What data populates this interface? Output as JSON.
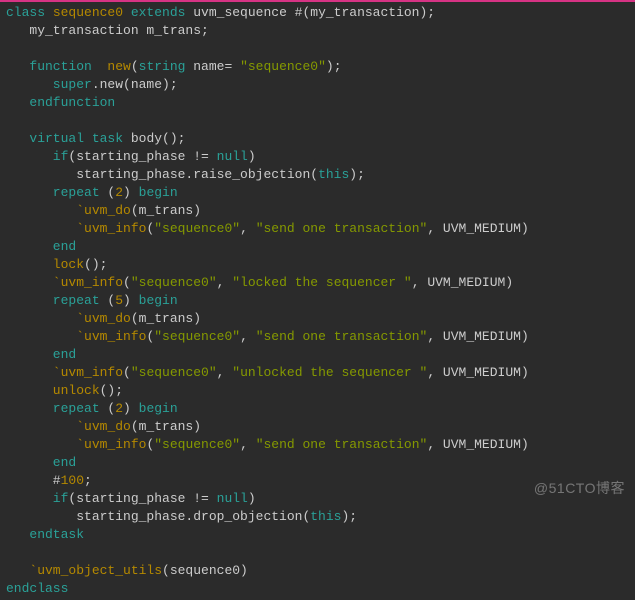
{
  "watermark": "@51CTO博客",
  "code": {
    "l1": {
      "a": "class ",
      "b": "sequence0 ",
      "c": "extends ",
      "d": "uvm_sequence #(my_transaction);"
    },
    "l2": "   my_transaction m_trans;",
    "l3": "",
    "l4": {
      "a": "   function  ",
      "b": "new",
      "c": "(",
      "d": "string ",
      "e": "name= ",
      "f": "\"sequence0\"",
      "g": ");"
    },
    "l5": {
      "a": "      super",
      "b": ".new(name);"
    },
    "l6": {
      "a": "   endfunction"
    },
    "l7": "",
    "l8": {
      "a": "   virtual ",
      "b": "task ",
      "c": "body();"
    },
    "l9": {
      "a": "      if",
      "b": "(starting_phase != ",
      "c": "null",
      "d": ")"
    },
    "l10": {
      "a": "         starting_phase.raise_objection(",
      "b": "this",
      "c": ");"
    },
    "l11": {
      "a": "      repeat ",
      "b": "(",
      "c": "2",
      "d": ") ",
      "e": "begin"
    },
    "l12": {
      "a": "         `uvm_do",
      "b": "(m_trans)"
    },
    "l13": {
      "a": "         `uvm_info",
      "b": "(",
      "c": "\"sequence0\"",
      "d": ", ",
      "e": "\"send one transaction\"",
      "f": ", UVM_MEDIUM)"
    },
    "l14": {
      "a": "      end"
    },
    "l15": {
      "a": "      lock",
      "b": "();"
    },
    "l16": {
      "a": "      `uvm_info",
      "b": "(",
      "c": "\"sequence0\"",
      "d": ", ",
      "e": "\"locked the sequencer \"",
      "f": ", UVM_MEDIUM)"
    },
    "l17": {
      "a": "      repeat ",
      "b": "(",
      "c": "5",
      "d": ") ",
      "e": "begin"
    },
    "l18": {
      "a": "         `uvm_do",
      "b": "(m_trans)"
    },
    "l19": {
      "a": "         `uvm_info",
      "b": "(",
      "c": "\"sequence0\"",
      "d": ", ",
      "e": "\"send one transaction\"",
      "f": ", UVM_MEDIUM)"
    },
    "l20": {
      "a": "      end"
    },
    "l21": {
      "a": "      `uvm_info",
      "b": "(",
      "c": "\"sequence0\"",
      "d": ", ",
      "e": "\"unlocked the sequencer \"",
      "f": ", UVM_MEDIUM)"
    },
    "l22": {
      "a": "      unlock",
      "b": "();"
    },
    "l23": {
      "a": "      repeat ",
      "b": "(",
      "c": "2",
      "d": ") ",
      "e": "begin"
    },
    "l24": {
      "a": "         `uvm_do",
      "b": "(m_trans)"
    },
    "l25": {
      "a": "         `uvm_info",
      "b": "(",
      "c": "\"sequence0\"",
      "d": ", ",
      "e": "\"send one transaction\"",
      "f": ", UVM_MEDIUM)"
    },
    "l26": {
      "a": "      end"
    },
    "l27": {
      "a": "      #",
      "b": "100",
      "c": ";"
    },
    "l28": {
      "a": "      if",
      "b": "(starting_phase != ",
      "c": "null",
      "d": ")"
    },
    "l29": {
      "a": "         starting_phase.drop_objection(",
      "b": "this",
      "c": ");"
    },
    "l30": {
      "a": "   endtask"
    },
    "l31": "",
    "l32": {
      "a": "   `uvm_object_utils",
      "b": "(sequence0)"
    },
    "l33": {
      "a": "endclass"
    }
  }
}
